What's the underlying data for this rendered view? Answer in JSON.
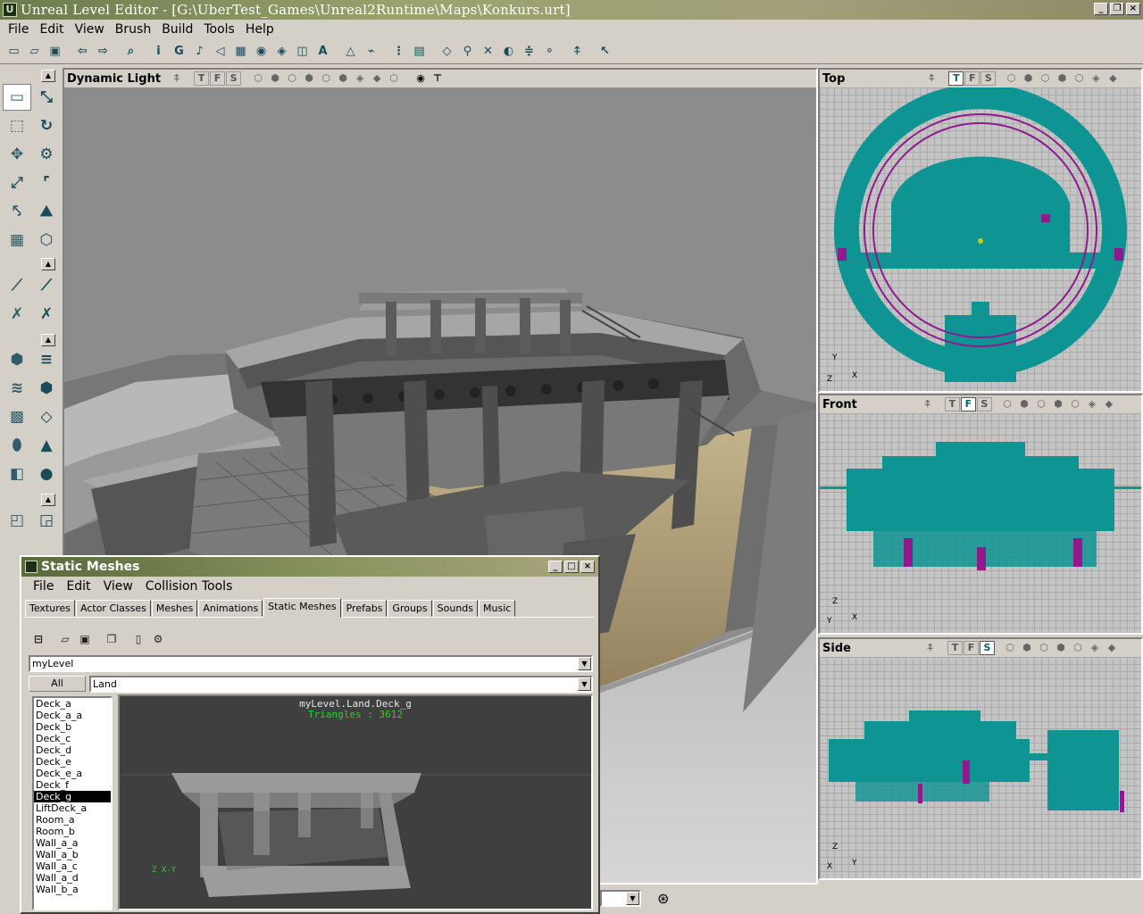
{
  "window": {
    "title": "Unreal Level Editor - [G:\\UberTest_Games\\Unreal2Runtime\\Maps\\Konkurs.urt]",
    "app_icon": "U"
  },
  "menu": [
    "File",
    "Edit",
    "View",
    "Brush",
    "Build",
    "Tools",
    "Help"
  ],
  "toolbar": [
    {
      "icon": "new-icon",
      "glyph": "▭"
    },
    {
      "icon": "open-icon",
      "glyph": "▱"
    },
    {
      "icon": "save-icon",
      "glyph": "▣"
    },
    null,
    {
      "icon": "undo-icon",
      "glyph": "⇦"
    },
    {
      "icon": "redo-icon",
      "glyph": "⇨"
    },
    null,
    {
      "icon": "search-icon",
      "glyph": "⌕"
    },
    null,
    {
      "icon": "actor-props-icon",
      "glyph": "i"
    },
    {
      "icon": "group-browser-icon",
      "glyph": "G"
    },
    {
      "icon": "music-icon",
      "glyph": "♪"
    },
    {
      "icon": "sound-icon",
      "glyph": "◁"
    },
    {
      "icon": "texture-icon",
      "glyph": "▦"
    },
    {
      "icon": "mesh-icon",
      "glyph": "◉"
    },
    {
      "icon": "static-mesh-icon",
      "glyph": "◈"
    },
    {
      "icon": "animation-icon",
      "glyph": "◫"
    },
    {
      "icon": "font-icon",
      "glyph": "A"
    },
    null,
    {
      "icon": "build-geometry-icon",
      "glyph": "△"
    },
    {
      "icon": "build-lighting-icon",
      "glyph": "⌁"
    },
    null,
    {
      "icon": "build-paths-icon",
      "glyph": "⋮"
    },
    {
      "icon": "build-all-icon",
      "glyph": "▤"
    },
    null,
    {
      "icon": "play-level-icon",
      "glyph": "◇"
    },
    {
      "icon": "light-icon",
      "glyph": "⚲"
    },
    {
      "icon": "kismet-icon",
      "glyph": "✕"
    },
    {
      "icon": "camera-icon",
      "glyph": "◐"
    },
    {
      "icon": "sliders-icon",
      "glyph": "≑"
    },
    {
      "icon": "bulb-icon",
      "glyph": "⚬"
    },
    null,
    {
      "icon": "actor-icon",
      "glyph": "⍏"
    },
    null,
    {
      "icon": "select-icon",
      "glyph": "↖"
    }
  ],
  "lefttools": [
    {
      "icon": "camera-move-icon",
      "glyph": "▭",
      "col": 0,
      "row": 0,
      "on": true
    },
    {
      "icon": "vertex-edit-icon",
      "glyph": "⤡",
      "col": 1,
      "row": 0
    },
    {
      "icon": "scale-icon",
      "glyph": "⬚",
      "col": 0,
      "row": 1
    },
    {
      "icon": "rotate-icon",
      "glyph": "↻",
      "col": 1,
      "row": 1
    },
    {
      "icon": "move-icon",
      "glyph": "✥",
      "col": 0,
      "row": 2
    },
    {
      "icon": "terrain-icon",
      "glyph": "⚙",
      "col": 1,
      "row": 2
    },
    {
      "icon": "brush-clip-icon",
      "glyph": "⤢",
      "col": 0,
      "row": 3
    },
    {
      "icon": "face-drag-icon",
      "glyph": "⌜",
      "col": 1,
      "row": 3
    },
    {
      "icon": "matinee-icon",
      "glyph": "⤣",
      "col": 0,
      "row": 4
    },
    {
      "icon": "geometry-icon",
      "glyph": "⛰",
      "col": 1,
      "row": 4
    },
    {
      "icon": "movie-icon",
      "glyph": "▦",
      "col": 0,
      "row": 5
    },
    {
      "icon": "cube-icon",
      "glyph": "⬡",
      "col": 1,
      "row": 5
    },
    {
      "icon": "clip-icon",
      "glyph": "⟋",
      "col": 0,
      "row": 6.6
    },
    {
      "icon": "clip-split-icon",
      "glyph": "⟋",
      "col": 1,
      "row": 6.6
    },
    {
      "icon": "clip-delete-icon",
      "glyph": "✗",
      "col": 0,
      "row": 7.6
    },
    {
      "icon": "clip-flip-icon",
      "glyph": "✗",
      "col": 1,
      "row": 7.6
    },
    {
      "icon": "cube-brush-icon",
      "glyph": "⬢",
      "col": 0,
      "row": 9.2
    },
    {
      "icon": "stair-icon",
      "glyph": "≡",
      "col": 1,
      "row": 9.2
    },
    {
      "icon": "curved-stair-icon",
      "glyph": "≋",
      "col": 0,
      "row": 10.2
    },
    {
      "icon": "spiral-stair-icon",
      "glyph": "⬢",
      "col": 1,
      "row": 10.2
    },
    {
      "icon": "terrain-brush-icon",
      "glyph": "▩",
      "col": 0,
      "row": 11.2
    },
    {
      "icon": "sheet-icon",
      "glyph": "◇",
      "col": 1,
      "row": 11.2
    },
    {
      "icon": "cylinder-icon",
      "glyph": "⬮",
      "col": 0,
      "row": 12.2
    },
    {
      "icon": "cone-icon",
      "glyph": "▲",
      "col": 1,
      "row": 12.2
    },
    {
      "icon": "volumetric-icon",
      "glyph": "◧",
      "col": 0,
      "row": 13.2
    },
    {
      "icon": "sphere-icon",
      "glyph": "●",
      "col": 1,
      "row": 13.2
    },
    {
      "icon": "add-brush-icon",
      "glyph": "◰",
      "col": 0,
      "row": 14.8
    },
    {
      "icon": "subtract-brush-icon",
      "glyph": "◲",
      "col": 1,
      "row": 14.8
    }
  ],
  "viewport_main": {
    "label": "Dynamic Light",
    "tfs": [
      "T",
      "F",
      "S"
    ]
  },
  "viewport_top": {
    "label": "Top",
    "tfs": [
      "T",
      "F",
      "S"
    ],
    "active": "T"
  },
  "viewport_front": {
    "label": "Front",
    "tfs": [
      "T",
      "F",
      "S"
    ],
    "active": "F"
  },
  "viewport_side": {
    "label": "Side",
    "tfs": [
      "T",
      "F",
      "S"
    ],
    "active": "S"
  },
  "axes": {
    "top": [
      "Y",
      "Z",
      "X"
    ],
    "front": [
      "Z",
      "Y",
      "X"
    ],
    "side": [
      "Z",
      "X",
      "Y"
    ]
  },
  "colors": {
    "mesh": "#0f9494",
    "path": "#8e1a8e",
    "accent": "#6b7b4c"
  },
  "static_meshes": {
    "title": "Static Meshes",
    "menu": [
      "File",
      "Edit",
      "View",
      "Collision Tools"
    ],
    "tabs": [
      "Textures",
      "Actor Classes",
      "Meshes",
      "Animations",
      "Static Meshes",
      "Prefabs",
      "Groups",
      "Sounds",
      "Music"
    ],
    "active_tab": "Static Meshes",
    "package": "myLevel",
    "all_label": "All",
    "group": "Land",
    "items": [
      "Deck_a",
      "Deck_a_a",
      "Deck_b",
      "Deck_c",
      "Deck_d",
      "Deck_e",
      "Deck_e_a",
      "Deck_f",
      "Deck_g",
      "LiftDeck_a",
      "Room_a",
      "Room_b",
      "Wall_a_a",
      "Wall_a_b",
      "Wall_a_c",
      "Wall_a_d",
      "Wall_b_a"
    ],
    "selected": "Deck_g",
    "preview_name": "myLevel.Land.Deck_g",
    "preview_tris": "Triangles : 3612",
    "preview_axes": "Z X-Y"
  }
}
